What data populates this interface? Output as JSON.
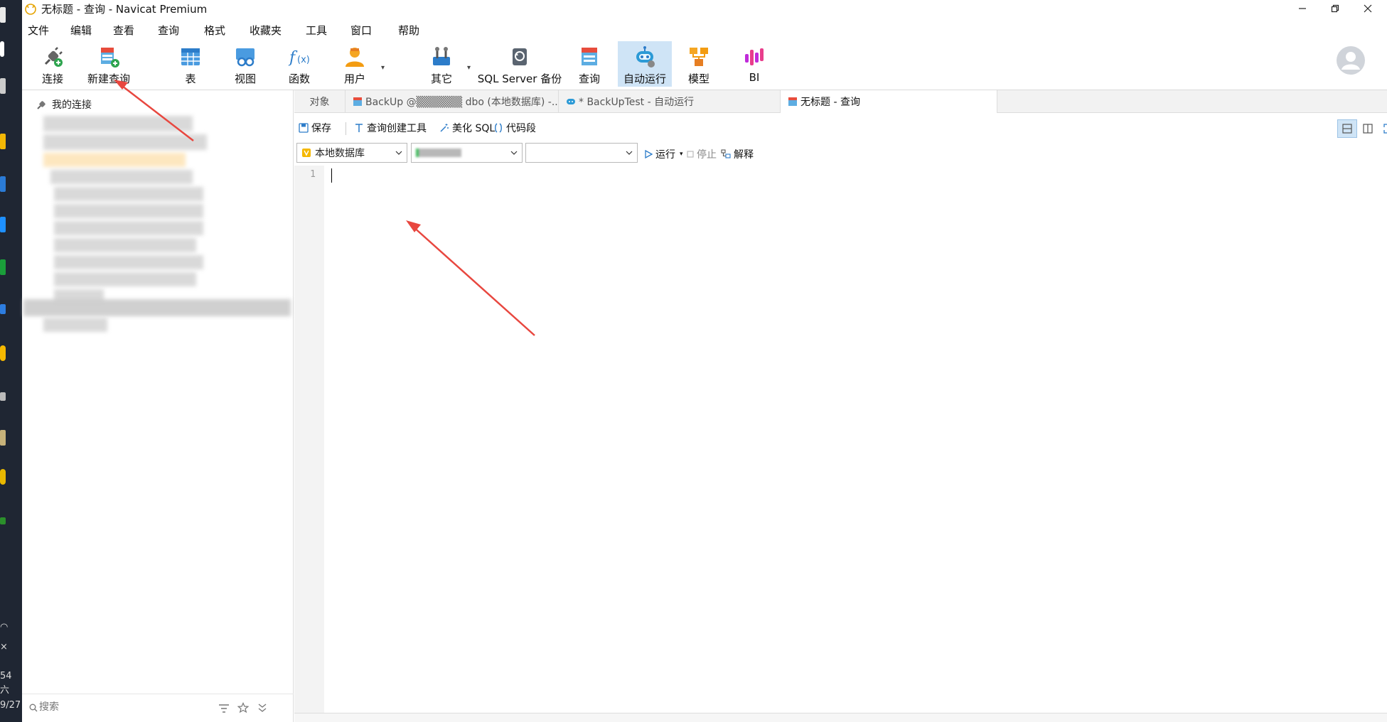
{
  "window": {
    "title": "无标题 - 查询 - Navicat Premium"
  },
  "os_strip": {
    "time_fragment": "54",
    "weekday_fragment": "六",
    "date_fragment": "9/27"
  },
  "menu": [
    "文件",
    "编辑",
    "查看",
    "查询",
    "格式",
    "收藏夹",
    "工具",
    "窗口",
    "帮助"
  ],
  "toolbar": {
    "connect": "连接",
    "new_query": "新建查询",
    "table": "表",
    "view": "视图",
    "function": "函数",
    "user": "用户",
    "other": "其它",
    "sqlserver_backup": "SQL Server 备份",
    "query": "查询",
    "automation": "自动运行",
    "model": "模型",
    "bi": "BI"
  },
  "sidebar": {
    "root_label": "我的连接",
    "search_placeholder": "搜索"
  },
  "tabs": [
    {
      "label": "对象"
    },
    {
      "label": "BackUp @▒▒▒▒▒▒ dbo (本地数据库) -..."
    },
    {
      "label": "* BackUpTest - 自动运行"
    },
    {
      "label": "无标题 - 查询"
    }
  ],
  "editor_toolbar": {
    "save": "保存",
    "query_builder": "查询创建工具",
    "beautify": "美化 SQL",
    "snippet": "代码段"
  },
  "selectors": {
    "connection": "本地数据库",
    "database": "",
    "schema": ""
  },
  "run_controls": {
    "run": "运行",
    "stop": "停止",
    "explain": "解释"
  },
  "editor": {
    "line_numbers": [
      "1"
    ]
  },
  "colors": {
    "accent_active": "#cfe4f6",
    "annotation_arrow": "#e8473f"
  }
}
